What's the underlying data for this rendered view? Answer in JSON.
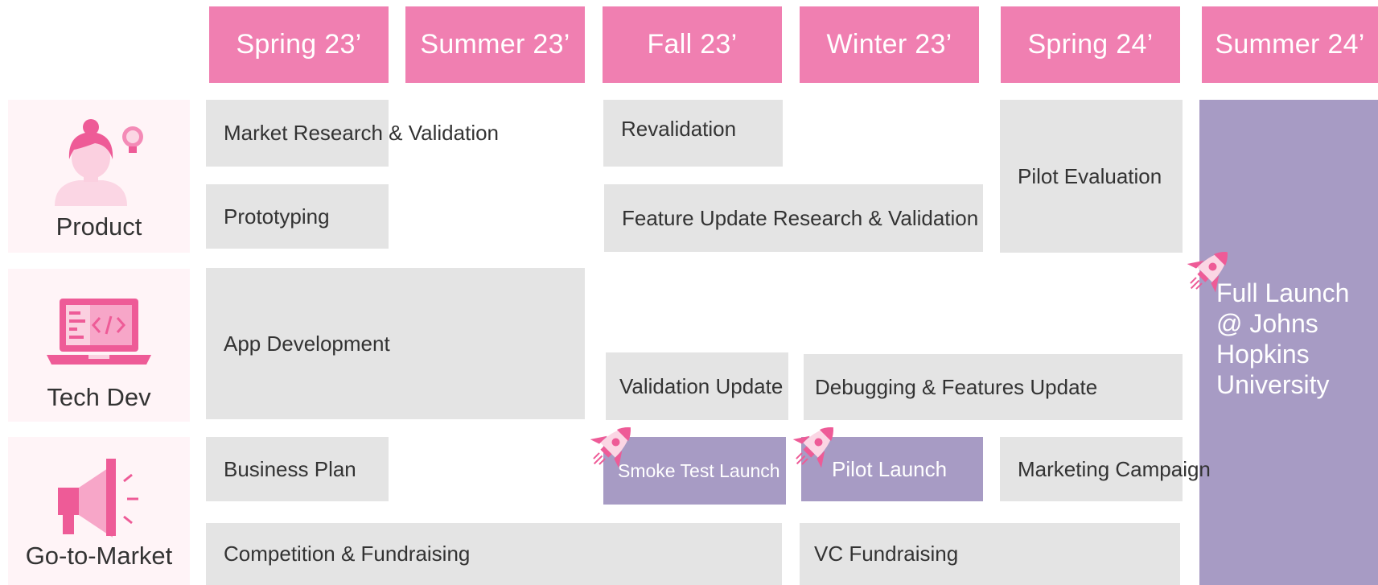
{
  "colors": {
    "header": "#f07fb1",
    "task": "#e4e4e4",
    "milestone": "#a79bc4",
    "category_bg": "#fff4f7",
    "text": "#333333"
  },
  "headers": [
    "Spring 23’",
    "Summer 23’",
    "Fall 23’",
    "Winter 23’",
    "Spring 24’",
    "Summer 24’"
  ],
  "categories": {
    "product": {
      "label": "Product",
      "icon": "woman-lightbulb-icon"
    },
    "tech": {
      "label": "Tech Dev",
      "icon": "laptop-code-icon"
    },
    "gtm": {
      "label": "Go-to-Market",
      "icon": "megaphone-icon"
    }
  },
  "tasks": {
    "market_research": "Market Research & Validation",
    "prototyping": "Prototyping",
    "revalidation": "Revalidation",
    "feature_update": "Feature Update Research & Validation",
    "pilot_evaluation": "Pilot Evaluation",
    "app_development": "App Development",
    "validation_update": "Validation Update",
    "debugging": "Debugging & Features Update",
    "business_plan": "Business Plan",
    "marketing_campaign": "Marketing Campaign",
    "competition": "Competition & Fundraising",
    "vc_fundraising": "VC Fundraising"
  },
  "milestones": {
    "smoke_test": "Smoke Test Launch",
    "pilot_launch": "Pilot Launch",
    "full_launch": [
      "Full Launch",
      "@ Johns",
      "Hopkins",
      "University"
    ]
  }
}
